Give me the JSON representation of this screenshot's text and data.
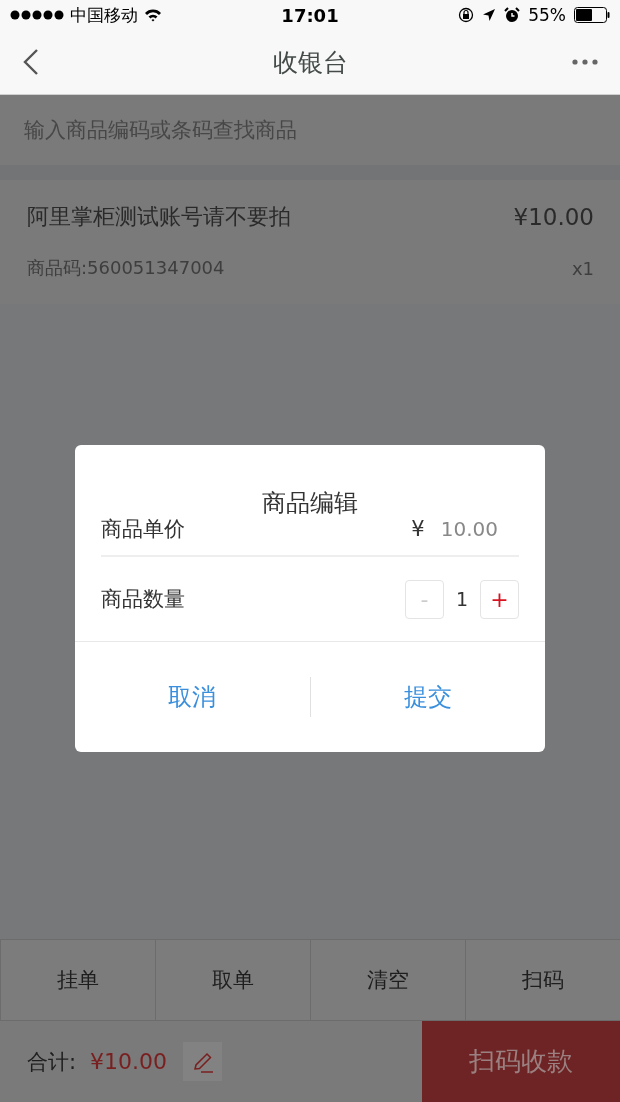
{
  "status_bar": {
    "carrier": "中国移动",
    "time": "17:01",
    "battery": "55%"
  },
  "nav": {
    "title": "收银台"
  },
  "search": {
    "placeholder": "输入商品编码或条码查找商品"
  },
  "items": [
    {
      "name": "阿里掌柜测试账号请不要拍",
      "price": "¥10.00",
      "code": "商品码:560051347004",
      "quantity": "x1"
    }
  ],
  "dialog": {
    "title": "商品编辑",
    "price_label": "商品单价",
    "currency": "¥",
    "price": "10.00",
    "quantity_label": "商品数量",
    "decrement": {
      "label": "-",
      "disabled": true
    },
    "quantity": "1",
    "increment": {
      "label": "+",
      "disabled": false
    },
    "buttons": [
      "取消",
      "提交"
    ]
  },
  "actions": [
    "挂单",
    "取单",
    "清空",
    "扫码"
  ],
  "footer": {
    "total_label": "合计:",
    "total": "¥10.00",
    "pay_button": "扫码收款"
  }
}
